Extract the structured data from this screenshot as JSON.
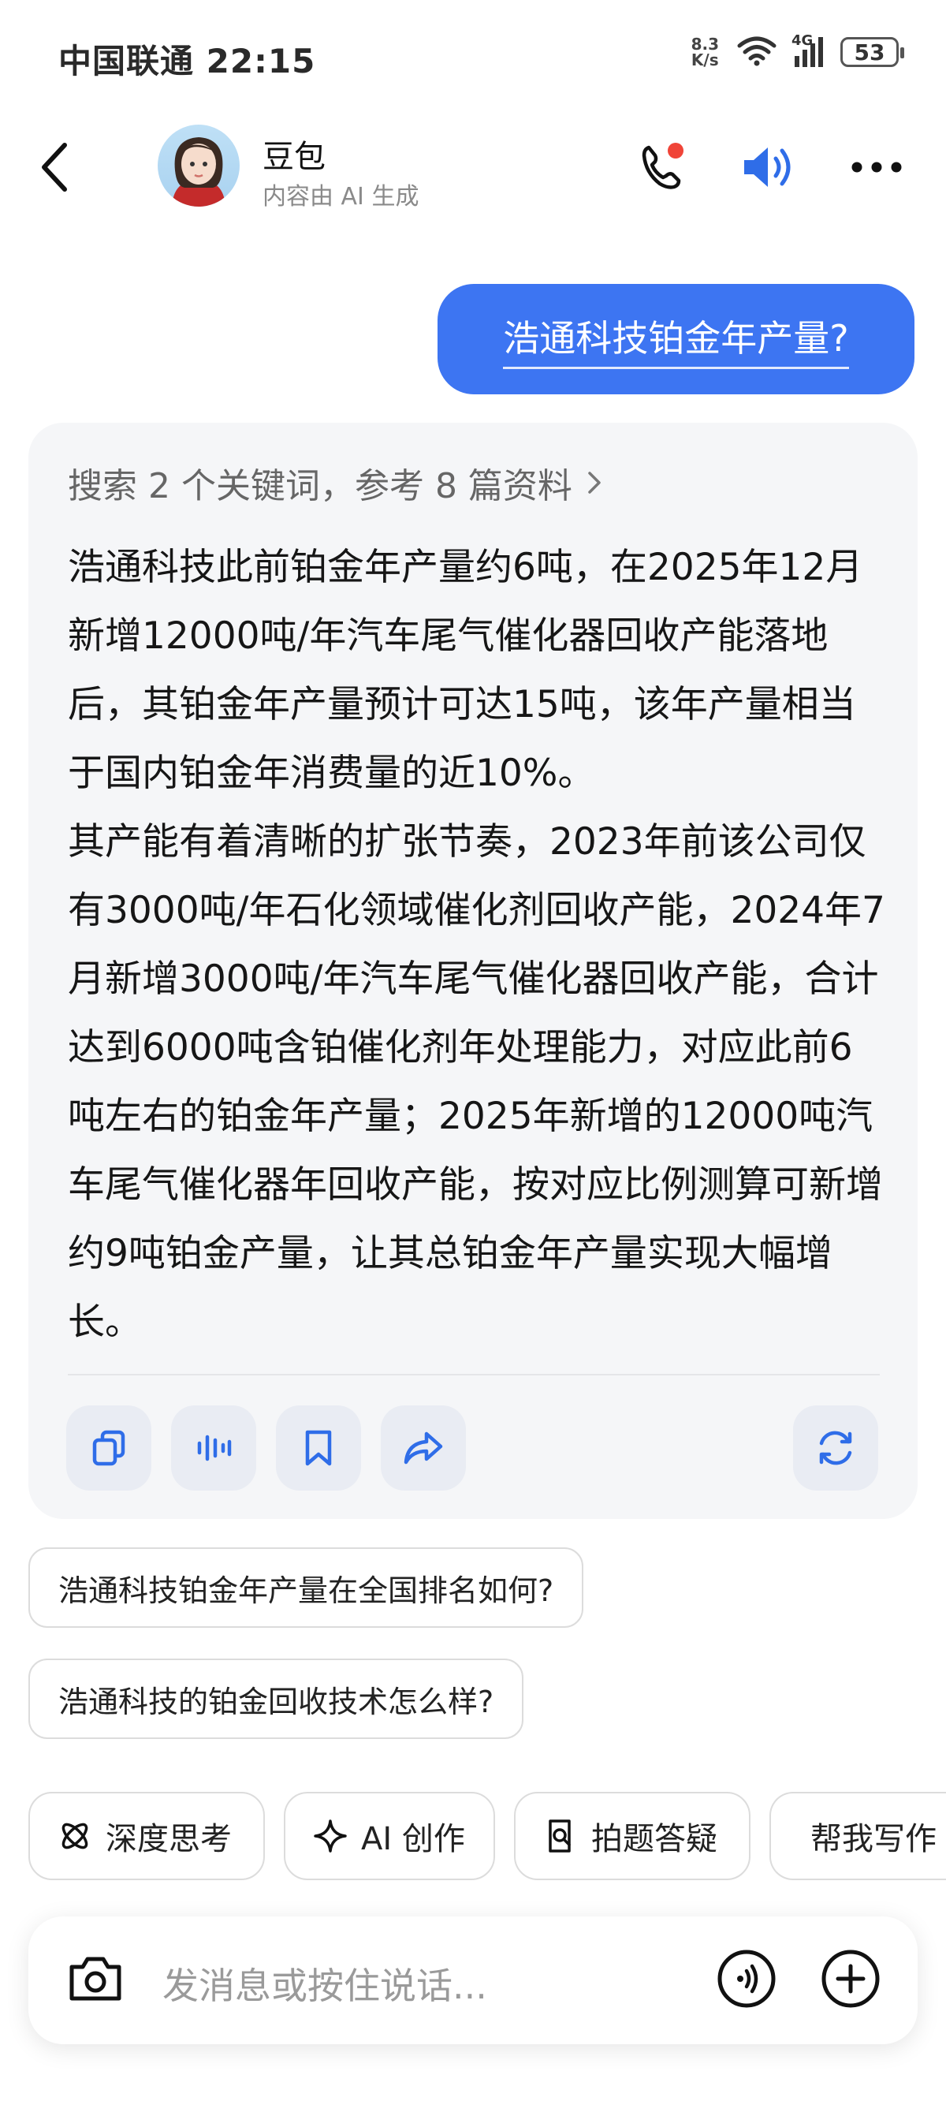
{
  "status": {
    "carrier_time": "中国联通 22:15",
    "net_speed_value": "8.3",
    "net_speed_unit": "K/s",
    "network": "4G",
    "battery": "53"
  },
  "header": {
    "name": "豆包",
    "subtitle": "内容由 AI 生成"
  },
  "user_message": "浩通科技铂金年产量?",
  "answer": {
    "search_summary": "搜索 2 个关键词，参考 8 篇资料",
    "paragraph1": "浩通科技此前铂金年产量约6吨，在2025年12月新增12000吨/年汽车尾气催化器回收产能落地后，其铂金年产量预计可达15吨，该年产量相当于国内铂金年消费量的近10%。",
    "paragraph2": "其产能有着清晰的扩张节奏，2023年前该公司仅有3000吨/年石化领域催化剂回收产能，2024年7月新增3000吨/年汽车尾气催化器回收产能，合计达到6000吨含铂催化剂年处理能力，对应此前6吨左右的铂金年产量；2025年新增的12000吨汽车尾气催化器年回收产能，按对应比例测算可新增约9吨铂金产量，让其总铂金年产量实现大幅增长。"
  },
  "suggestions": [
    "浩通科技铂金年产量在全国排名如何?",
    "浩通科技的铂金回收技术怎么样?"
  ],
  "chips": [
    {
      "label": "深度思考",
      "icon": "atom-icon"
    },
    {
      "label": "AI 创作",
      "icon": "sparkle-icon"
    },
    {
      "label": "拍题答疑",
      "icon": "scan-doc-icon"
    },
    {
      "label": "帮我写作",
      "icon": "edit-icon"
    }
  ],
  "input": {
    "placeholder": "发消息或按住说话..."
  },
  "colors": {
    "accent": "#3d75f2",
    "icon_blue": "#2f6de8",
    "notify_red": "#f04438"
  }
}
